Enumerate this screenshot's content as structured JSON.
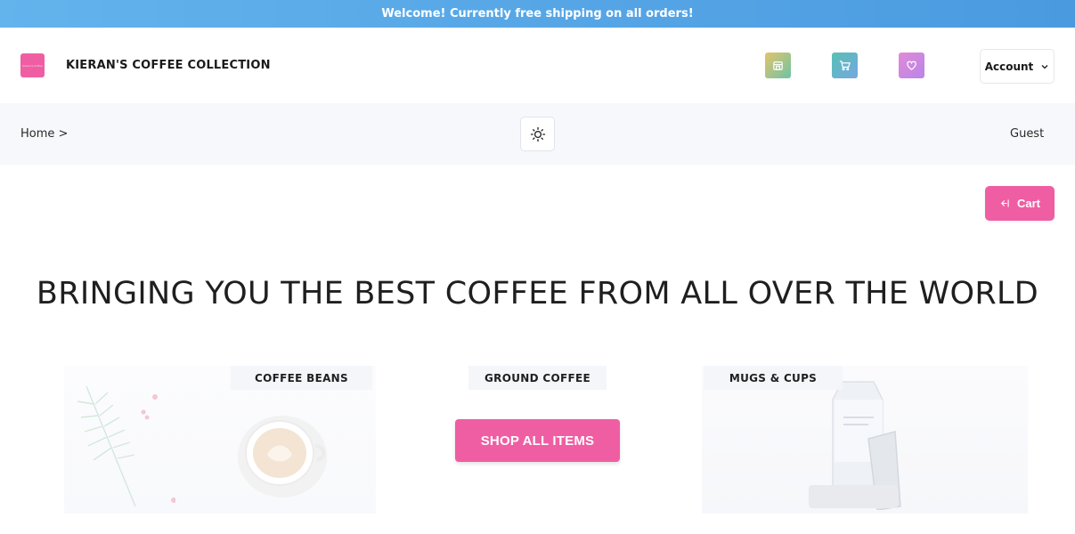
{
  "promo": {
    "text": "Welcome! Currently free shipping on all orders!"
  },
  "header": {
    "logo_text": "Kieran's Coffee",
    "brand": "KIERAN'S COFFEE COLLECTION",
    "icons": [
      "store-icon",
      "cart-icon",
      "heart-icon"
    ],
    "account_label": "Account"
  },
  "subbar": {
    "breadcrumb": "Home >",
    "user": "Guest"
  },
  "main": {
    "cart_label": "Cart",
    "hero_title": "BRINGING YOU THE BEST COFFEE FROM ALL OVER THE WORLD",
    "categories": [
      "COFFEE BEANS",
      "GROUND COFFEE",
      "MUGS & CUPS"
    ],
    "shop_all_label": "SHOP ALL ITEMS"
  },
  "colors": {
    "accent": "#ef5ea3",
    "promo_bar": "#55a7e8",
    "subbar_bg": "#f6f8fb"
  }
}
